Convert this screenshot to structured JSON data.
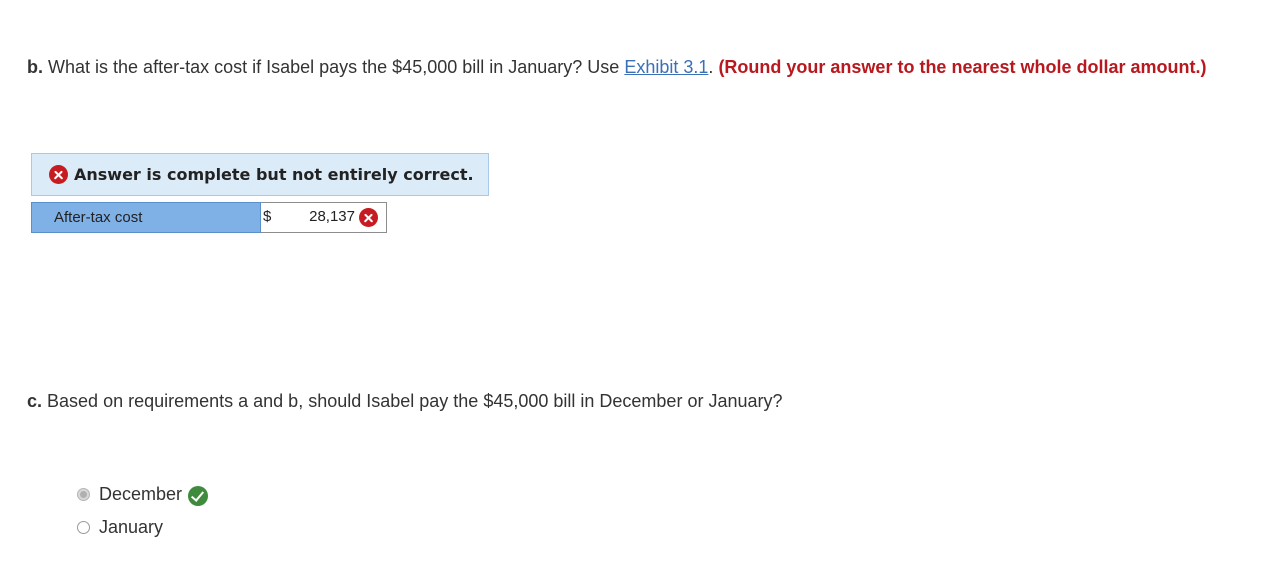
{
  "question_b": {
    "letter": "b.",
    "text": "What is the after-tax cost if Isabel pays the $45,000 bill in January? Use",
    "link": "Exhibit 3.1",
    "after_link": ".",
    "instruction": "(Round your answer to the nearest whole dollar amount.)"
  },
  "feedback_banner": {
    "icon": "x-circle-icon",
    "text": "Answer is complete but not entirely correct."
  },
  "answer_row": {
    "label": "After-tax cost",
    "currency": "$",
    "value": "28,137",
    "status_icon": "x-circle-icon"
  },
  "question_c": {
    "letter": "c.",
    "text": "Based on requirements a and b, should Isabel pay the $45,000 bill in December or January?"
  },
  "options": [
    {
      "label": "December",
      "selected": true,
      "status_icon": "check-circle-icon"
    },
    {
      "label": "January",
      "selected": false
    }
  ],
  "colors": {
    "error_red": "#c71b22",
    "correct_green": "#3e8b3e",
    "link_blue": "#3b6fb6",
    "banner_bg": "#dcebf8",
    "label_bg": "#7fb0e6"
  }
}
